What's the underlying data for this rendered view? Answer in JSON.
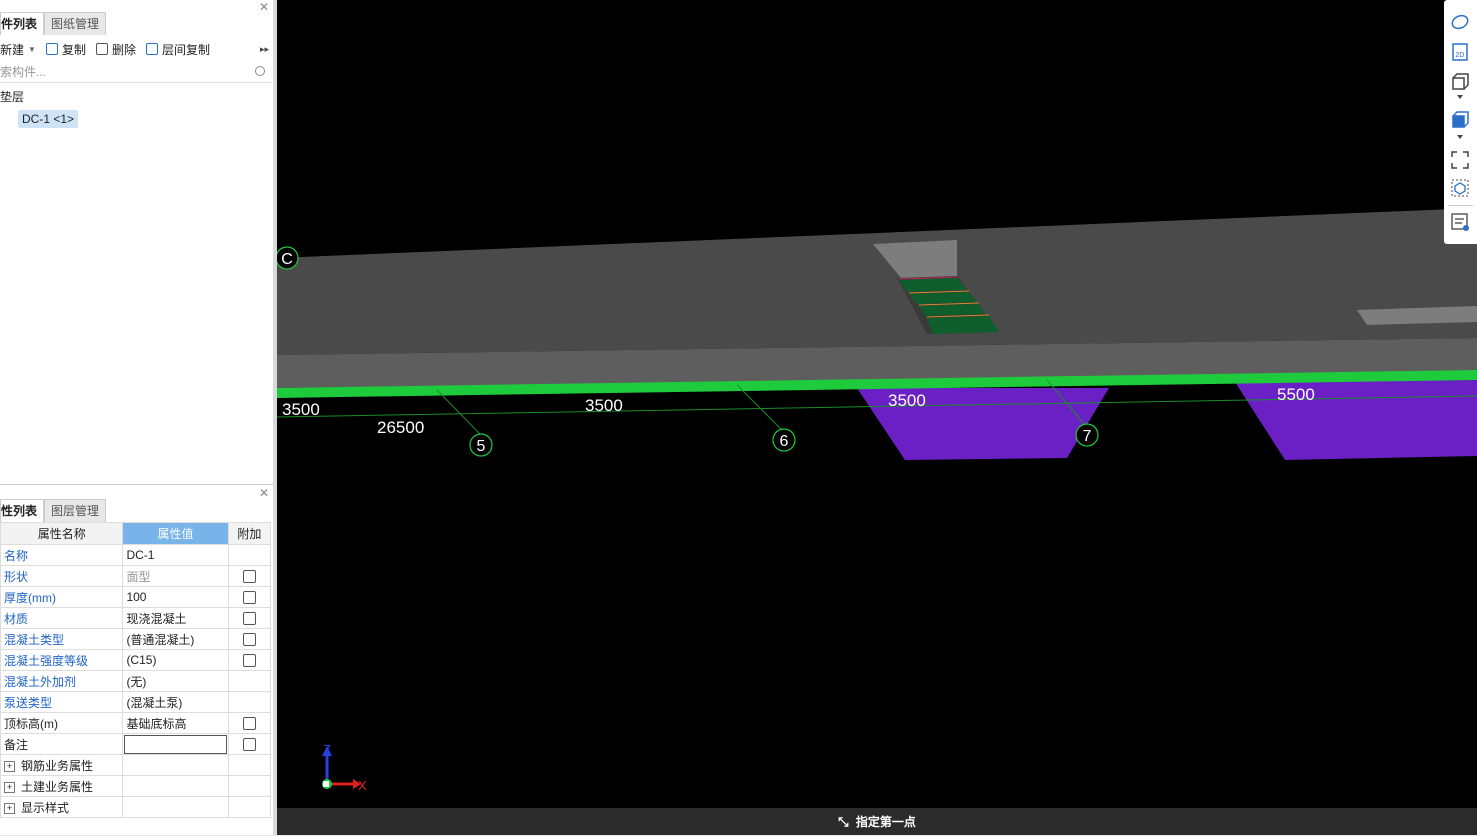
{
  "component_panel": {
    "tabs": [
      {
        "label": "件列表"
      },
      {
        "label": "图纸管理"
      }
    ],
    "toolbar": {
      "new_label": "新建",
      "copy_label": "复制",
      "delete_label": "删除",
      "floor_copy_label": "层间复制"
    },
    "search_placeholder": "索构件...",
    "tree": {
      "group_label": "垫层",
      "item_label": "DC-1 <1>"
    }
  },
  "property_panel": {
    "tabs": [
      {
        "label": "性列表"
      },
      {
        "label": "图层管理"
      }
    ],
    "headers": {
      "name": "属性名称",
      "value": "属性值",
      "extra": "附加"
    },
    "rows": [
      {
        "name": "名称",
        "value": "DC-1"
      },
      {
        "name": "形状",
        "value": "面型"
      },
      {
        "name": "厚度(mm)",
        "value": "100"
      },
      {
        "name": "材质",
        "value": "现浇混凝土"
      },
      {
        "name": "混凝土类型",
        "value": "(普通混凝土)"
      },
      {
        "name": "混凝土强度等级",
        "value": "(C15)"
      },
      {
        "name": "混凝土外加剂",
        "value": "(无)"
      },
      {
        "name": "泵送类型",
        "value": "(混凝土泵)"
      },
      {
        "name": "顶标高(m)",
        "value": "基础底标高"
      },
      {
        "name": "备注",
        "value": ""
      }
    ],
    "groups": [
      {
        "label": "钢筋业务属性"
      },
      {
        "label": "土建业务属性"
      },
      {
        "label": "显示样式"
      }
    ]
  },
  "viewport": {
    "dimensions": [
      "3500",
      "26500",
      "3500",
      "3500",
      "5500"
    ],
    "axis_markers": [
      "5",
      "6",
      "7",
      "C"
    ],
    "axes": {
      "x": "X",
      "z": "Z"
    },
    "colors": {
      "slab": "#4a4a4a",
      "slab_face": "#585858",
      "beam_green": "#1ecb3c",
      "footing_purple": "#6a20c4"
    }
  },
  "status": {
    "prompt": "指定第一点"
  },
  "view_toolbar": {
    "icons": [
      "orbit-icon",
      "2d-view-icon",
      "3d-box-icon",
      "3d-box-filled-icon",
      "fullscreen-icon",
      "cube-view-icon",
      "layer-display-icon"
    ]
  }
}
